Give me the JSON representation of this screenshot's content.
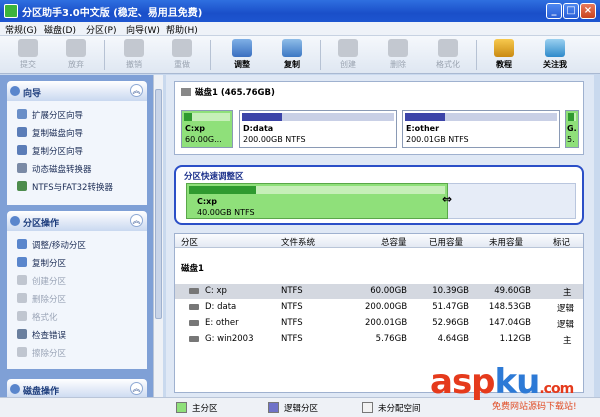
{
  "window": {
    "title": "分区助手3.0中文版 (稳定、易用且免费)",
    "colors": {
      "titlebar": "#1a4fc9"
    }
  },
  "menu": [
    "常规(G)",
    "磁盘(D)",
    "分区(P)",
    "向导(W)",
    "帮助(H)"
  ],
  "toolbar": [
    {
      "label": "提交",
      "icon": "check-icon",
      "enabled": false
    },
    {
      "label": "放弃",
      "icon": "cancel-icon",
      "enabled": false
    },
    {
      "label": "撤销",
      "icon": "undo-icon",
      "enabled": false
    },
    {
      "label": "重做",
      "icon": "redo-icon",
      "enabled": false
    },
    {
      "label": "调整",
      "icon": "resize-icon",
      "enabled": true
    },
    {
      "label": "复制",
      "icon": "copy-icon",
      "enabled": true
    },
    {
      "label": "创建",
      "icon": "create-icon",
      "enabled": false
    },
    {
      "label": "删除",
      "icon": "delete-icon",
      "enabled": false
    },
    {
      "label": "格式化",
      "icon": "format-icon",
      "enabled": false
    },
    {
      "label": "教程",
      "icon": "tutorial-icon",
      "enabled": true
    },
    {
      "label": "关注我",
      "icon": "follow-icon",
      "enabled": true
    }
  ],
  "sidebar": {
    "wizard": {
      "title": "向导",
      "items": [
        "扩展分区向导",
        "复制磁盘向导",
        "复制分区向导",
        "动态磁盘转换器",
        "NTFS与FAT32转换器"
      ]
    },
    "partition_ops": {
      "title": "分区操作",
      "items": [
        {
          "label": "调整/移动分区",
          "enabled": true
        },
        {
          "label": "复制分区",
          "enabled": true
        },
        {
          "label": "创建分区",
          "enabled": false
        },
        {
          "label": "删除分区",
          "enabled": false
        },
        {
          "label": "格式化",
          "enabled": false
        },
        {
          "label": "检查错误",
          "enabled": true
        },
        {
          "label": "擦除分区",
          "enabled": false
        }
      ]
    },
    "disk_ops": {
      "title": "磁盘操作"
    }
  },
  "disk_map": {
    "disk_label": "磁盘1 (465.76GB)",
    "partitions": [
      {
        "name": "C:xp",
        "size": "60.00G...",
        "type": "primary",
        "used_fraction": 0.17
      },
      {
        "name": "D:data",
        "size": "200.00GB NTFS",
        "type": "logical",
        "used_fraction": 0.26
      },
      {
        "name": "E:other",
        "size": "200.01GB NTFS",
        "type": "logical",
        "used_fraction": 0.26
      },
      {
        "name": "G.",
        "size": "5.",
        "type": "primary",
        "used_fraction": 0.8
      }
    ]
  },
  "quick_resize": {
    "title": "分区快速调整区",
    "partition_name": "C:xp",
    "partition_size": "40.00GB NTFS",
    "used_fraction": 0.26
  },
  "table": {
    "columns": [
      "分区",
      "文件系统",
      "总容量",
      "已用容量",
      "未用容量",
      "标记"
    ],
    "group": "磁盘1",
    "rows": [
      {
        "partition": "C: xp",
        "fs": "NTFS",
        "total": "60.00GB",
        "used": "10.39GB",
        "free": "49.60GB",
        "flag": "主",
        "selected": true
      },
      {
        "partition": "D: data",
        "fs": "NTFS",
        "total": "200.00GB",
        "used": "51.47GB",
        "free": "148.53GB",
        "flag": "逻辑",
        "selected": false
      },
      {
        "partition": "E: other",
        "fs": "NTFS",
        "total": "200.01GB",
        "used": "52.96GB",
        "free": "147.04GB",
        "flag": "逻辑",
        "selected": false
      },
      {
        "partition": "G: win2003",
        "fs": "NTFS",
        "total": "5.76GB",
        "used": "4.64GB",
        "free": "1.12GB",
        "flag": "主",
        "selected": false
      }
    ]
  },
  "legend": [
    {
      "label": "主分区",
      "color": "#8fe07a"
    },
    {
      "label": "逻辑分区",
      "color": "#6f72c8"
    },
    {
      "label": "未分配空间",
      "color": "#f2f2f2"
    }
  ],
  "watermark": {
    "brand_a": "asp",
    "brand_b": "ku",
    "suffix": ".com",
    "sub": "免费网站源码下载站!"
  }
}
